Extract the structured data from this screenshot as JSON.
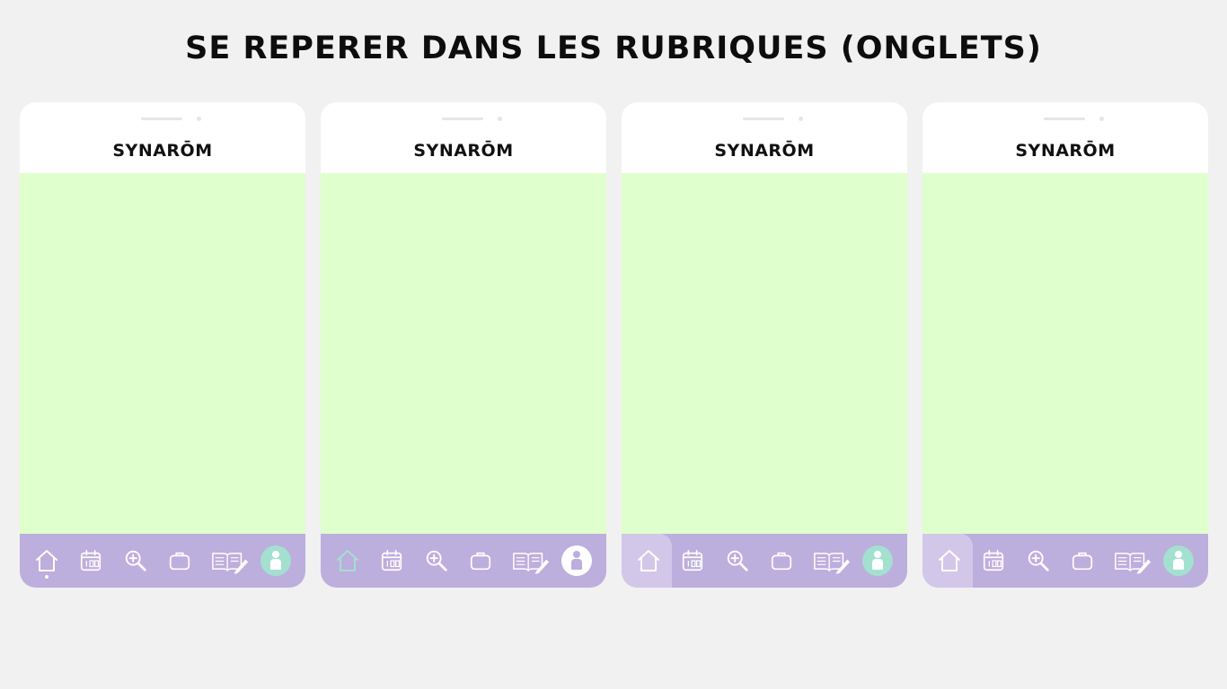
{
  "title": "SE REPERER DANS LES RUBRIQUES (ONGLETS)",
  "colors": {
    "background": "#f1f1f1",
    "screen": "#dfffcc",
    "tabbar": "#bcaedd",
    "tab_highlight": "#d2c7e9",
    "accent_teal": "#a3e0cf",
    "icon": "#ffffff"
  },
  "phones": [
    {
      "brand": "SYNARŌM",
      "tabs": [
        "home-icon",
        "calendar-icon",
        "search-icon",
        "briefcase-icon",
        "notebook-icon",
        "profile-icon"
      ],
      "state": "home tab active (dot indicator), teal profile avatar"
    },
    {
      "brand": "SYNARŌM",
      "tabs": [
        "home-icon",
        "calendar-icon",
        "search-icon",
        "briefcase-icon",
        "notebook-icon",
        "profile-icon"
      ],
      "state": "home icon teal, white profile avatar"
    },
    {
      "brand": "SYNARŌM",
      "tabs": [
        "home-icon",
        "calendar-icon",
        "search-icon",
        "briefcase-icon",
        "notebook-icon",
        "profile-icon"
      ],
      "state": "home tab highlighted, teal profile avatar"
    },
    {
      "brand": "SYNARŌM",
      "tabs": [
        "home-icon",
        "calendar-icon",
        "search-icon",
        "briefcase-icon",
        "notebook-icon",
        "profile-icon"
      ],
      "state": "home tab highlighted, teal profile avatar"
    }
  ]
}
